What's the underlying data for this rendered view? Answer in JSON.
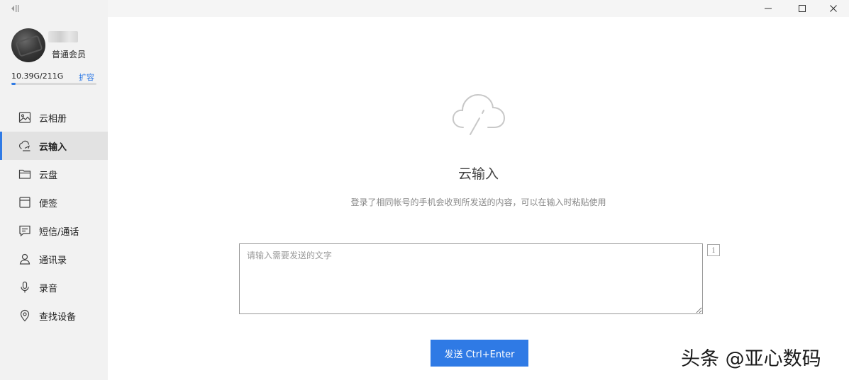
{
  "user": {
    "member_level": "普通会员"
  },
  "storage": {
    "text": "10.39G/211G",
    "used_fraction": 0.049,
    "expand_label": "扩容"
  },
  "nav": {
    "items": [
      {
        "label": "云相册",
        "icon": "photo-album-icon"
      },
      {
        "label": "云输入",
        "icon": "cloud-input-icon",
        "active": true
      },
      {
        "label": "云盘",
        "icon": "folder-icon"
      },
      {
        "label": "便签",
        "icon": "notepad-icon"
      },
      {
        "label": "短信/通话",
        "icon": "message-icon"
      },
      {
        "label": "通讯录",
        "icon": "contact-icon"
      },
      {
        "label": "录音",
        "icon": "microphone-icon"
      },
      {
        "label": "查找设备",
        "icon": "location-pin-icon"
      }
    ]
  },
  "main": {
    "title": "云输入",
    "description": "登录了相同帐号的手机会收到所发送的内容，可以在输入时粘贴使用",
    "input_placeholder": "请输入需要发送的文字",
    "info_label": "i",
    "send_label": "发送 Ctrl+Enter"
  },
  "watermark": "头条 @亚心数码",
  "colors": {
    "accent": "#2f7ae5",
    "sidebar_bg": "#f2f2f2",
    "active_bg": "#e2e2e2"
  }
}
